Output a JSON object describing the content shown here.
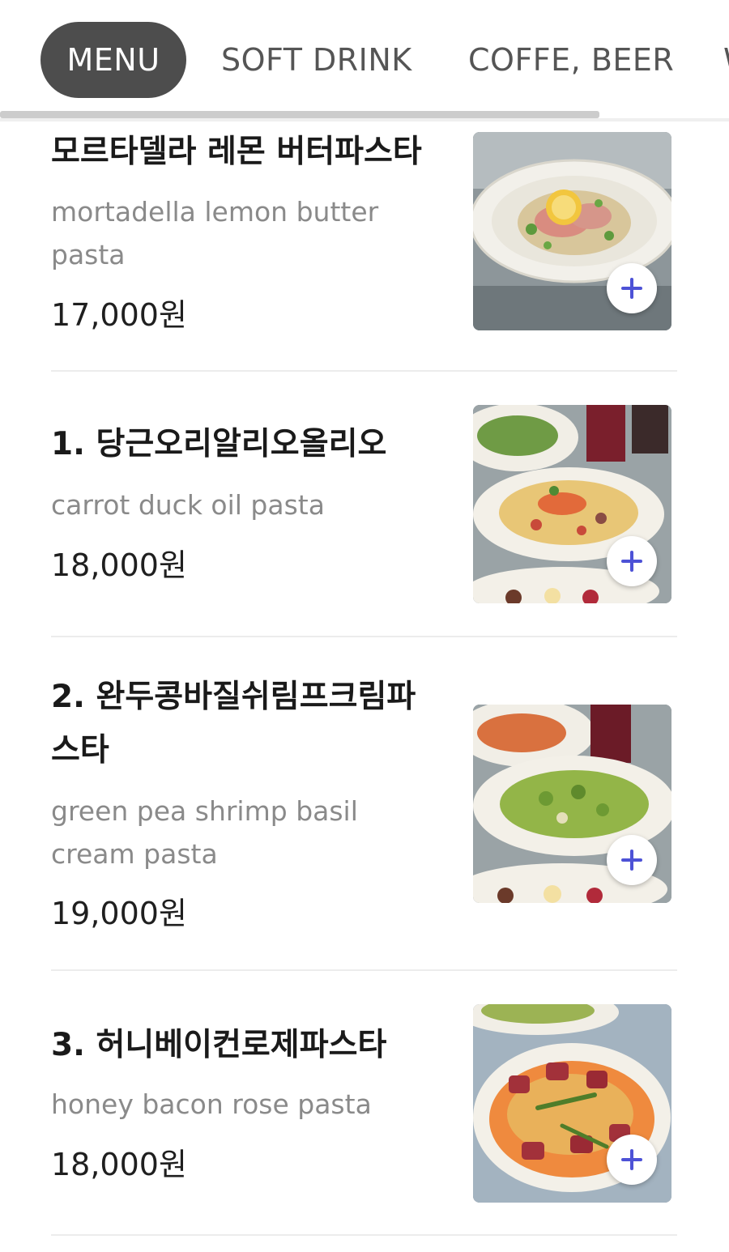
{
  "tabs": [
    {
      "label": "MENU",
      "active": true
    },
    {
      "label": "SOFT DRINK",
      "active": false
    },
    {
      "label": "COFFE, BEER",
      "active": false
    },
    {
      "label": "W",
      "active": false
    }
  ],
  "colors": {
    "active_tab_bg": "#4d4d4d",
    "add_button_plus": "#4d52d6",
    "description_text": "#8a8a8a"
  },
  "menu_items": [
    {
      "name": "모르타델라 레몬 버터파스타",
      "description": "mortadella lemon butter pasta",
      "price": "17,000원",
      "image_icon": "pasta-dish-image",
      "add_icon": "plus-icon"
    },
    {
      "name": "1. 당근오리알리오올리오",
      "description": "carrot duck oil pasta",
      "price": "18,000원",
      "image_icon": "pasta-dish-image",
      "add_icon": "plus-icon"
    },
    {
      "name": "2. 완두콩바질쉬림프크림파스타",
      "description": "green pea shrimp basil cream pasta",
      "price": "19,000원",
      "image_icon": "pasta-dish-image",
      "add_icon": "plus-icon"
    },
    {
      "name": "3. 허니베이컨로제파스타",
      "description": "honey bacon rose pasta",
      "price": "18,000원",
      "image_icon": "pasta-dish-image",
      "add_icon": "plus-icon"
    }
  ]
}
